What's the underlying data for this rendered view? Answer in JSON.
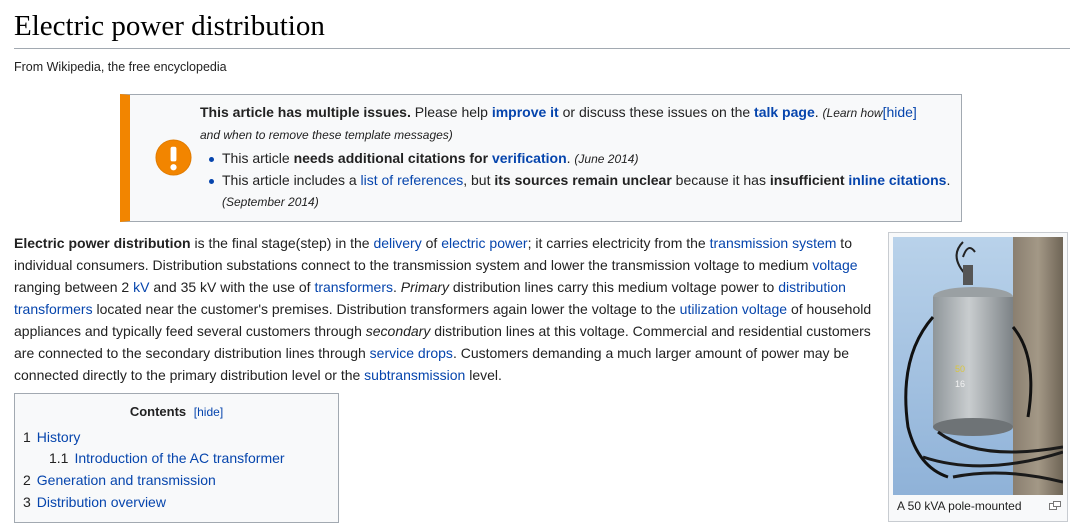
{
  "page": {
    "title": "Electric power distribution",
    "tagline": "From Wikipedia, the free encyclopedia"
  },
  "ambox": {
    "line1_bold": "This article has multiple issues.",
    "line1_mid": " Please help ",
    "improve_link": "improve it",
    "line1_mid2": " or discuss these issues on the ",
    "talk_link": "talk page",
    "line1_end": ". ",
    "learn_how_open": "(Learn how",
    "hide_link": "[hide]",
    "learn_how_rest": "and when to remove these template messages)",
    "issue1_pre": "This article ",
    "issue1_bold": "needs additional citations for ",
    "issue1_link": "verification",
    "issue1_end": ".",
    "issue1_date": "(June 2014)",
    "issue2_pre": "This article includes a ",
    "issue2_link": "list of references",
    "issue2_mid": ", but ",
    "issue2_bold1": "its sources remain unclear",
    "issue2_mid2": " because it has ",
    "issue2_bold2": "insufficient ",
    "issue2_link2": "inline citations",
    "issue2_end": ".",
    "issue2_date": "(September 2014)"
  },
  "intro": {
    "t1": "Electric power distribution",
    "t2": " is the final stage(step) in the ",
    "l1": "delivery",
    "t3": " of ",
    "l2": "electric power",
    "t4": "; it carries electricity from the ",
    "l3": "transmission system",
    "t5": " to individual consumers. Distribution substations connect to the transmission system and lower the transmission voltage to medium ",
    "l4": "voltage",
    "t6": " ranging between 2 ",
    "l5": "kV",
    "t7": " and 35 kV with the use of ",
    "l6": "transformers",
    "t8": ". ",
    "t9": "Primary",
    "t10": " distribution lines carry this medium voltage power to ",
    "l7": "distribution transformers",
    "t11": " located near the customer's premises. Distribution transformers again lower the voltage to the ",
    "l8": "utilization voltage",
    "t12": " of household appliances and typically feed several customers through ",
    "t13": "secondary",
    "t14": " distribution lines at this voltage. Commercial and residential customers are connected to the secondary distribution lines through ",
    "l9": "service drops",
    "t15": ". Customers demanding a much larger amount of power may be connected directly to the primary distribution level or the ",
    "l10": "subtransmission",
    "t16": " level."
  },
  "toc": {
    "title": "Contents",
    "hide": "[hide]",
    "items": [
      {
        "num": "1",
        "label": "History"
      },
      {
        "num": "1.1",
        "label": "Introduction of the AC transformer"
      },
      {
        "num": "2",
        "label": "Generation and transmission"
      },
      {
        "num": "3",
        "label": "Distribution overview"
      }
    ]
  },
  "thumb": {
    "caption": "A 50 kVA pole-mounted",
    "label_top": "50",
    "label_bottom": "16"
  },
  "colors": {
    "link": "#0645ad",
    "ambox_border": "#f28500",
    "warning_icon": "#f28500"
  }
}
